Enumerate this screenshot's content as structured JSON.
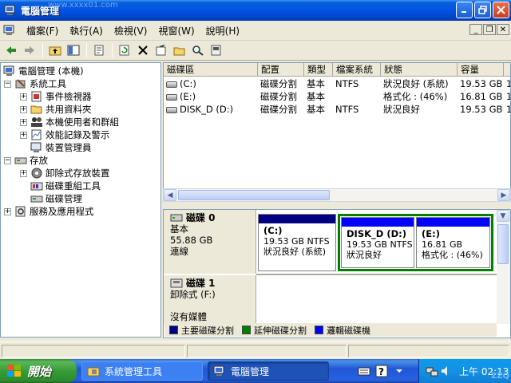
{
  "window": {
    "title": "電腦管理",
    "watermark": "www.xxxx01.com"
  },
  "menu": [
    "檔案(F)",
    "執行(A)",
    "檢視(V)",
    "視窗(W)",
    "說明(H)"
  ],
  "tree": {
    "root": "電腦管理 (本機)",
    "items": [
      {
        "label": "系統工具",
        "level": 1,
        "expander": "−"
      },
      {
        "label": "事件檢視器",
        "level": 2,
        "expander": "+"
      },
      {
        "label": "共用資料夾",
        "level": 2,
        "expander": "+"
      },
      {
        "label": "本機使用者和群組",
        "level": 2,
        "expander": "+"
      },
      {
        "label": "效能記錄及警示",
        "level": 2,
        "expander": "+"
      },
      {
        "label": "裝置管理員",
        "level": 2,
        "expander": ""
      },
      {
        "label": "存放",
        "level": 1,
        "expander": "−"
      },
      {
        "label": "卸除式存放裝置",
        "level": 2,
        "expander": "+"
      },
      {
        "label": "磁碟重組工具",
        "level": 2,
        "expander": ""
      },
      {
        "label": "磁碟管理",
        "level": 2,
        "expander": ""
      },
      {
        "label": "服務及應用程式",
        "level": 1,
        "expander": "+"
      }
    ]
  },
  "volumes": {
    "columns": [
      "磁碟區",
      "配置",
      "類型",
      "檔案系統",
      "狀態",
      "容量",
      ""
    ],
    "rows": [
      [
        "(C:)",
        "磁碟分割",
        "基本",
        "NTFS",
        "狀況良好 (系統)",
        "19.53 GB",
        "1"
      ],
      [
        "(E:)",
        "磁碟分割",
        "基本",
        "",
        "格式化 : (46%)",
        "16.81 GB",
        "1"
      ],
      [
        "DISK_D (D:)",
        "磁碟分割",
        "基本",
        "NTFS",
        "狀況良好",
        "19.53 GB",
        "1"
      ]
    ]
  },
  "disks": [
    {
      "name": "磁碟 0",
      "type": "基本",
      "size": "55.88 GB",
      "status": "連線",
      "partitions": [
        {
          "name": "(C:)",
          "size": "19.53 GB NTFS",
          "status": "狀況良好 (系統)",
          "bar_color": "#000080"
        },
        {
          "name": "DISK_D (D:)",
          "size": "19.53 GB NTFS",
          "status": "狀況良好",
          "bar_color": "#0000ff"
        },
        {
          "name": "(E:)",
          "size": "16.81 GB",
          "status": "格式化 : (46%)",
          "bar_color": "#0000ff"
        }
      ]
    },
    {
      "name": "磁碟 1",
      "type": "卸除式 (F:)",
      "status": "沒有媒體"
    }
  ],
  "legend": [
    {
      "label": "主要磁碟分割",
      "color": "#000080"
    },
    {
      "label": "延伸磁碟分割",
      "color": "#008000"
    },
    {
      "label": "邏輯磁碟機",
      "color": "#0000ff"
    }
  ],
  "taskbar": {
    "start": "開始",
    "tasks": [
      "系統管理工具",
      "電腦管理"
    ],
    "clock": "上午 02:13",
    "watermark": "ZZQ"
  },
  "colors": {
    "extended_outline": "#008000",
    "primary": "#000080",
    "logical": "#0000ff"
  }
}
